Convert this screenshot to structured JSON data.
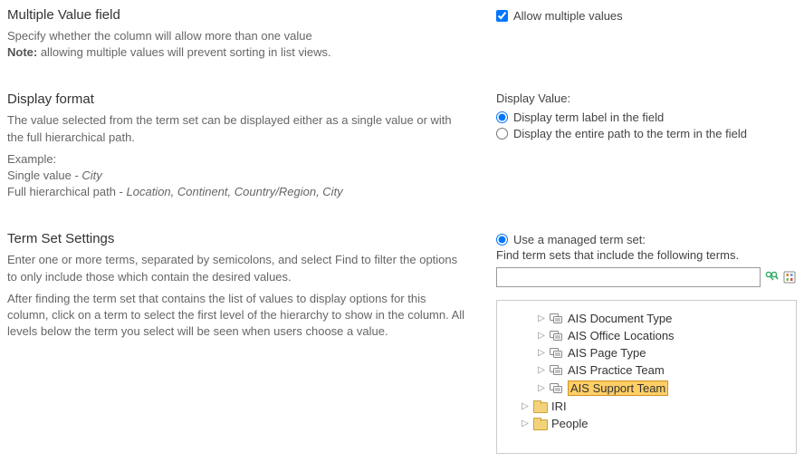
{
  "multi": {
    "heading": "Multiple Value field",
    "desc_line1": "Specify whether the column will allow more than one value",
    "note_prefix": "Note:",
    "note_rest": " allowing multiple values will prevent sorting in list views.",
    "checkbox_label": "Allow multiple values",
    "checked": true
  },
  "display": {
    "heading": "Display format",
    "desc": "The value selected from the term set can be displayed either as a single value or with the full hierarchical path.",
    "example_label": "Example:",
    "ex_single_prefix": "Single value - ",
    "ex_single_italic": "City",
    "ex_full_prefix": "Full hierarchical path - ",
    "ex_full_italic": "Location, Continent, Country/Region, City",
    "right_heading": "Display Value:",
    "radio1": "Display term label in the field",
    "radio2": "Display the entire path to the term in the field"
  },
  "termset": {
    "heading": "Term Set Settings",
    "desc1": "Enter one or more terms, separated by semicolons, and select Find to filter the options to only include those which contain the desired values.",
    "desc2": "After finding the term set that contains the list of values to display options for this column, click on a term to select the first level of the hierarchy to show in the column. All levels below the term you select will be seen when users choose a value.",
    "use_managed_label": "Use a managed term set:",
    "find_hint": "Find term sets that include the following terms.",
    "search_value": "",
    "tree": [
      {
        "indent": 2,
        "icon": "termset",
        "label": "AIS Document Type",
        "selected": false
      },
      {
        "indent": 2,
        "icon": "termset",
        "label": "AIS Office Locations",
        "selected": false
      },
      {
        "indent": 2,
        "icon": "termset",
        "label": "AIS Page Type",
        "selected": false
      },
      {
        "indent": 2,
        "icon": "termset",
        "label": "AIS Practice Team",
        "selected": false
      },
      {
        "indent": 2,
        "icon": "termset",
        "label": "AIS Support Team",
        "selected": true
      },
      {
        "indent": 1,
        "icon": "folder",
        "label": "IRI",
        "selected": false
      },
      {
        "indent": 1,
        "icon": "folder",
        "label": "People",
        "selected": false
      }
    ]
  }
}
